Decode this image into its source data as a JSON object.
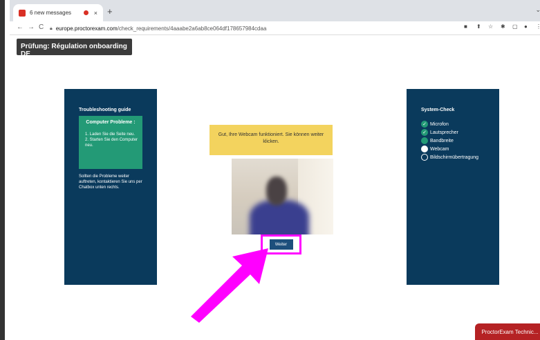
{
  "browser": {
    "tab_title": "6 new messages",
    "tab_close": "×",
    "new_tab": "+",
    "tab_menu": "⌄",
    "nav_back": "←",
    "nav_forward": "→",
    "nav_reload": "C",
    "url_host": "europe.proctorexam.com",
    "url_path": "/check_requirements/4aaabe2a6ab8ce064df178657984cdaa",
    "extension_icons": [
      "■",
      "⬆",
      "☆",
      "✱",
      "▢",
      "●",
      "⋮"
    ]
  },
  "page": {
    "exam_title": "Prüfung: Régulation onboarding DE",
    "troubleshooting": {
      "heading": "Troubleshooting guide",
      "box_title": "Computer Probleme :",
      "steps": [
        "1. Laden Sie die Seite neu.",
        "2. Starten Sie den Computer neu."
      ],
      "text": "Sollten die Probleme weiter auftreten, kontaktieren Sie uns per Chatbox unten rechts."
    },
    "message": "Gut, Ihre Webcam funktioniert. Sie können weiter klicken.",
    "next_button": "Weiter",
    "system_check": {
      "heading": "System-Check",
      "items": [
        {
          "label": "Microfon",
          "status": "done"
        },
        {
          "label": "Lautsprecher",
          "status": "done"
        },
        {
          "label": "Bandbreite",
          "status": "in-progress"
        },
        {
          "label": "Webcam",
          "status": "active"
        },
        {
          "label": "Bildschirmübertragung",
          "status": "pending"
        }
      ]
    },
    "chat_button": "ProctorExam Technic..."
  },
  "colors": {
    "panel": "#0a3a5c",
    "green": "#239a76",
    "message": "#f3d35e",
    "highlight": "#ff00ff",
    "chat": "#b52224"
  }
}
